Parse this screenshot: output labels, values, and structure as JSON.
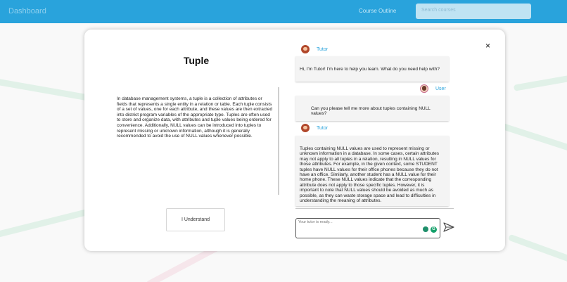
{
  "background": {
    "brand": "Dashboard",
    "nav_item": "Course Outline",
    "search_placeholder": "Search courses",
    "header_color": "#29a3dc"
  },
  "modal": {
    "title": "Tuple",
    "body": "In database management systems, a tuple is a collection of attributes or fields that represents a single entity in a relation or table. Each tuple consists of a set of values, one for each attribute, and these values are then extracted into district program variables of the appropriate type. Tuples are often used to store and organize data, with attributes and tuple values being ordered for convenience. Additionally, NULL values can be introduced into tuples to represent missing or unknown information, although it is generally recommended to avoid the use of NULL values whenever possible.",
    "understand_button": "I Understand",
    "close_label": "×"
  },
  "chat": {
    "messages": [
      {
        "sender": "Tutor",
        "text": "Hi, I'm Tutor! I'm here to help you learn. What do you need help with?"
      },
      {
        "sender": "User",
        "text": "Can you please tell me more about tuples containing NULL values?"
      },
      {
        "sender": "Tutor",
        "text": "Tuples containing NULL values are used to represent missing or unknown information in a database. In some cases, certain attributes may not apply to all tuples in a relation, resulting in NULL values for those attributes. For example, in the given context, some STUDENT tuples have NULL values for their office phones because they do not have an office. Similarly, another student has a NULL value for their home phone. These NULL values indicate that the corresponding attribute does not apply to those specific tuples. However, it is important to note that NULL values should be avoided as much as possible, as they can waste storage space and lead to difficulties in understanding the meaning of attributes."
      }
    ],
    "input_placeholder": "Your tutor is ready...",
    "grammar_badge": "G",
    "icons": {
      "send": "send-icon",
      "mic": "mic-icon",
      "grammar": "grammar-icon"
    }
  }
}
